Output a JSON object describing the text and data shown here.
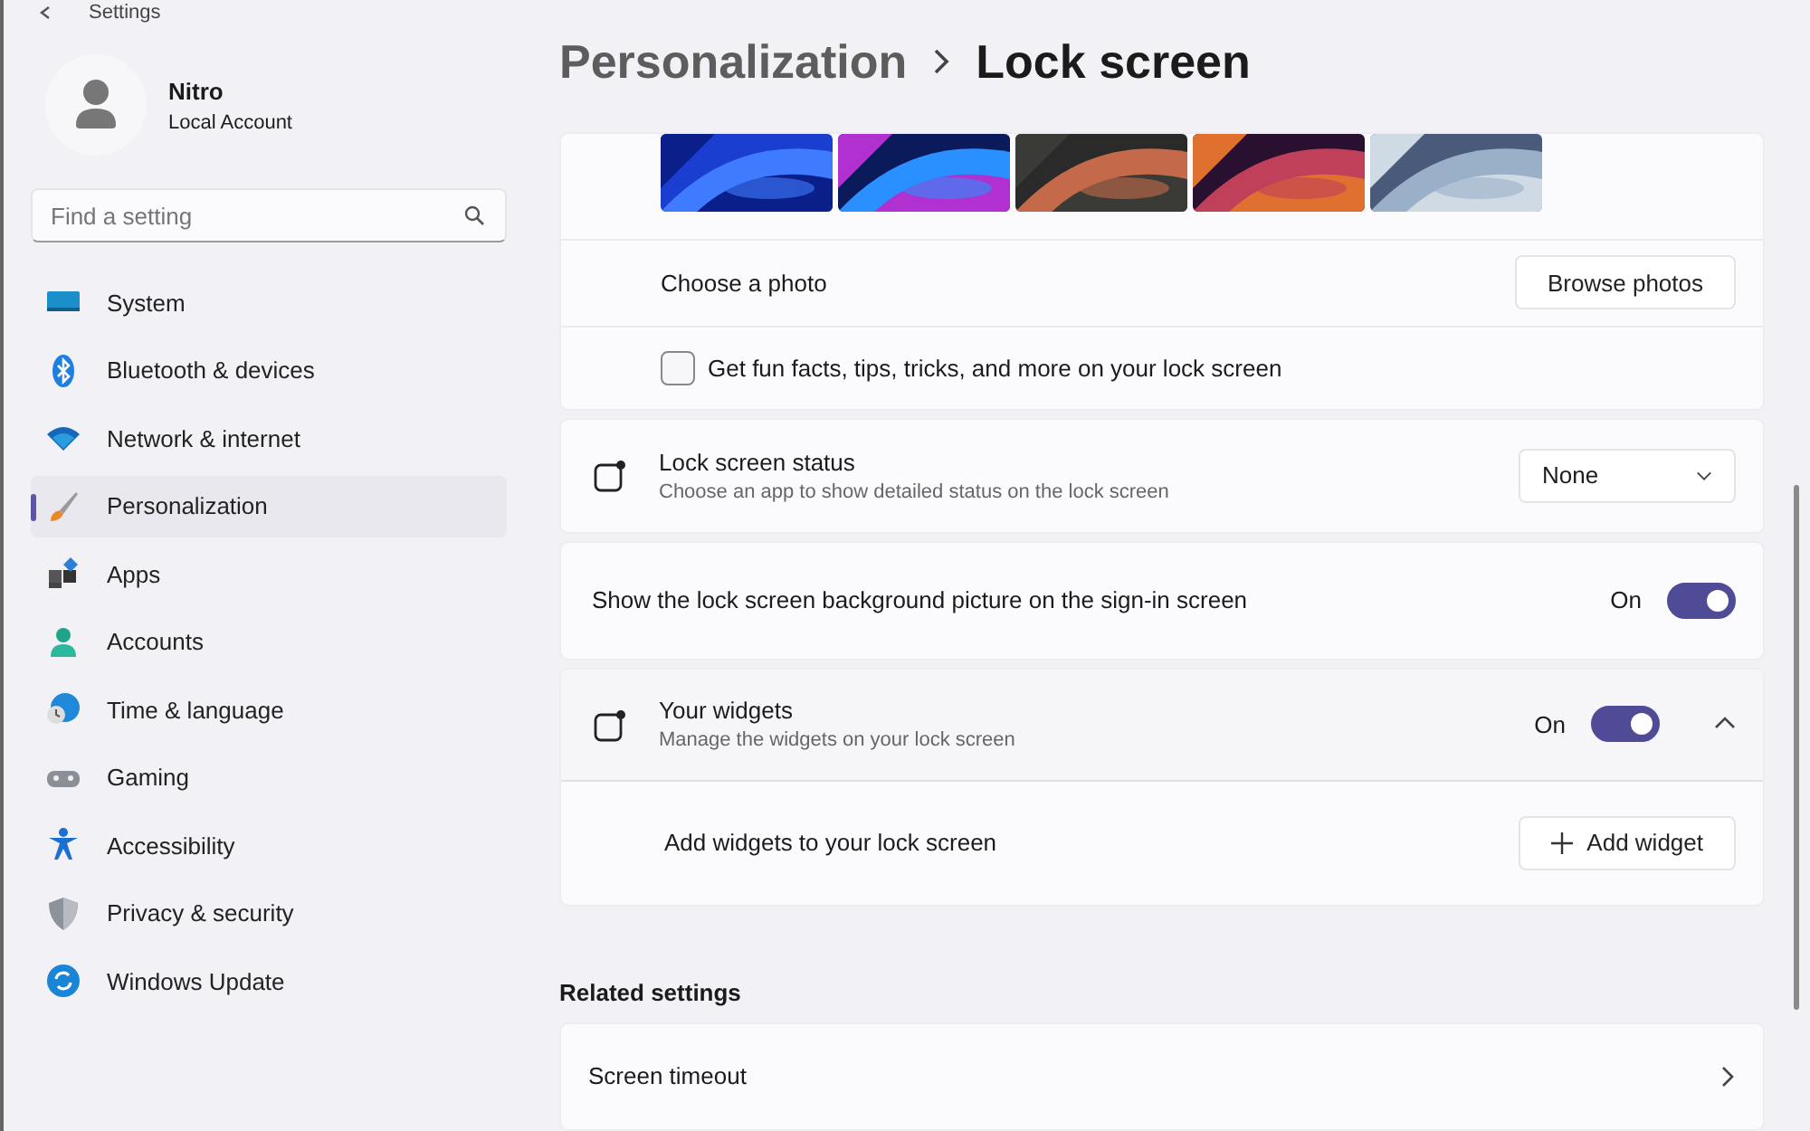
{
  "window": {
    "title": "Settings"
  },
  "account": {
    "name": "Nitro",
    "type": "Local Account"
  },
  "search": {
    "placeholder": "Find a setting"
  },
  "nav": [
    {
      "label": "System",
      "selected": false
    },
    {
      "label": "Bluetooth & devices",
      "selected": false
    },
    {
      "label": "Network & internet",
      "selected": false
    },
    {
      "label": "Personalization",
      "selected": true
    },
    {
      "label": "Apps",
      "selected": false
    },
    {
      "label": "Accounts",
      "selected": false
    },
    {
      "label": "Time & language",
      "selected": false
    },
    {
      "label": "Gaming",
      "selected": false
    },
    {
      "label": "Accessibility",
      "selected": false
    },
    {
      "label": "Privacy & security",
      "selected": false
    },
    {
      "label": "Windows Update",
      "selected": false
    }
  ],
  "breadcrumb": [
    "Personalization",
    "Lock screen"
  ],
  "background": {
    "choose_photo": {
      "label": "Choose a photo",
      "button": "Browse photos"
    },
    "fun_facts": {
      "label": "Get fun facts, tips, tricks, and more on your lock screen",
      "checked": false
    }
  },
  "status": {
    "title": "Lock screen status",
    "subtitle": "Choose an app to show detailed status on the lock screen",
    "value": "None"
  },
  "signin": {
    "label": "Show the lock screen background picture on the sign-in screen",
    "state": "On",
    "on": true
  },
  "widgets": {
    "title": "Your widgets",
    "subtitle": "Manage the widgets on your lock screen",
    "state": "On",
    "on": true,
    "expanded": true,
    "add": {
      "label": "Add widgets to your lock screen",
      "button": "Add widget"
    }
  },
  "related": {
    "heading": "Related settings",
    "items": [
      {
        "label": "Screen timeout"
      }
    ]
  }
}
